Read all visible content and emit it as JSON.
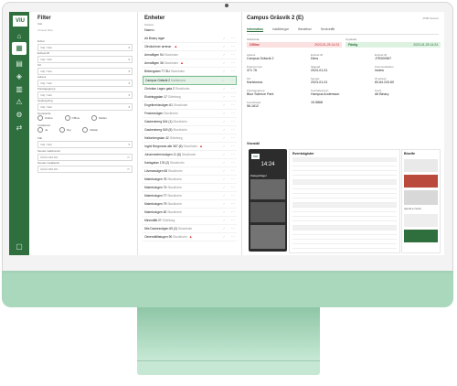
{
  "sidebar": {
    "logo_text": "VIU",
    "icons": [
      "home-icon",
      "grid-icon",
      "building-icon",
      "map-icon",
      "chart-icon",
      "alert-icon",
      "settings-icon",
      "swap-icon",
      "info-icon"
    ],
    "active_index": 1
  },
  "filter": {
    "title": "Filter",
    "saved_label": "Sök",
    "saved_value": "Choose filter",
    "groups": [
      {
        "label": "Enhet",
        "value": "Välj / Sätt"
      },
      {
        "label": "Enhets ID",
        "value": "Välj / Sätt"
      },
      {
        "label": "Ort",
        "value": "Välj / Sätt"
      },
      {
        "label": "Adress",
        "value": "Välj / Sätt"
      },
      {
        "label": "Företagsgrupp",
        "value": "Välj / Sätt"
      },
      {
        "label": "Uppkoppling",
        "value": "Välj / Sätt"
      }
    ],
    "status_label": "Nuvarande",
    "status_options": [
      "Online",
      "Offline",
      "Mellan"
    ],
    "installed_label": "Installerad",
    "installed_options": [
      "Ja",
      "Nej",
      "Mellan"
    ],
    "field_label": "Fält",
    "field_value": "Välj / Sätt",
    "date_from_label": "Senast inaktiverad",
    "date_from_value": "ÅÅÅÅ-MM-DD",
    "date_to_label": "Senast installerad",
    "date_to_value": "ÅÅÅÅ-MM-DD"
  },
  "units": {
    "title": "Enheter",
    "sort_label": "Sortera",
    "sort_value": "Namn",
    "items": [
      {
        "name": "Alt Binary lager",
        "city": "",
        "warn": false
      },
      {
        "name": "Olrvikofoner arrenar",
        "city": "",
        "warn": true
      },
      {
        "name": "Armatågen 54",
        "city": "Stockholm",
        "warn": false
      },
      {
        "name": "Armatågen 36",
        "city": "Stockholm",
        "warn": true
      },
      {
        "name": "Birkengatan 77 SU",
        "city": "Stockholm",
        "warn": false
      },
      {
        "name": "Campus Gräsvik 2",
        "city": "Karlskrona",
        "warn": false
      },
      {
        "name": "Christian Lagns gata 2",
        "city": "Stockholm",
        "warn": false
      },
      {
        "name": "Ekotringgatan 17",
        "city": "Göteborg",
        "warn": false
      },
      {
        "name": "Engelbrektsvägen 61",
        "city": "Stockholm",
        "warn": false
      },
      {
        "name": "Finskesvägen",
        "city": "Stockholm",
        "warn": false
      },
      {
        "name": "Gasbersberg 544 (1)",
        "city": "Stockholm",
        "warn": false
      },
      {
        "name": "Gasbersberg 549 (5)",
        "city": "Stockholm",
        "warn": false
      },
      {
        "name": "Hallonbergstan 42",
        "city": "Göteborg",
        "warn": false
      },
      {
        "name": "Ingrid Bergmans alle 367 (6)",
        "city": "Stockholm",
        "warn": true
      },
      {
        "name": "Johannesfrensvägen 11 (6)",
        "city": "Stockholm",
        "warn": false
      },
      {
        "name": "Karlsgatan 176 (2)",
        "city": "Stockholm",
        "warn": false
      },
      {
        "name": "Lövmasvägen 65",
        "city": "Stockholm",
        "warn": false
      },
      {
        "name": "Malmbolugen 76",
        "city": "Stockholm",
        "warn": false
      },
      {
        "name": "Malmbolugen 74",
        "city": "Stockholm",
        "warn": false
      },
      {
        "name": "Malmbolugen 77",
        "city": "Stockholm",
        "warn": false
      },
      {
        "name": "Malmbolugen 79",
        "city": "Stockholm",
        "warn": false
      },
      {
        "name": "Malmbolugen 82",
        "city": "Stockholm",
        "warn": false
      },
      {
        "name": "Minestfält 27",
        "city": "Göteborg",
        "warn": false
      },
      {
        "name": "Nils Dackesvägen 69 (2)",
        "city": "Stockholm",
        "warn": false
      },
      {
        "name": "Olmersfälltstugen 90",
        "city": "Stockholm",
        "warn": true
      }
    ],
    "selected_index": 5
  },
  "detail": {
    "title": "Campus Gräsvik 2 (E)",
    "top_right": "2598 Sessen",
    "tabs": [
      "Information",
      "Inställningar",
      "Händelser",
      "Servicelått"
    ],
    "active_tab": 0,
    "status_left_label": "Webbsida",
    "status_left_tag": "Offline",
    "status_left_time": "2023-01-25 14:24",
    "status_right_label": "Uppdatat",
    "status_right_tag": "Färdig",
    "status_right_time": "2023-01-25 14:24",
    "fields": [
      {
        "k": "Adress",
        "v": "Campus Gräsvik 2"
      },
      {
        "k": "Enhets ID",
        "v": "Dims"
      },
      {
        "k": "Enhets ID",
        "v": "J7E000967"
      },
      {
        "k": "Postnummer",
        "v": "371 76"
      },
      {
        "k": "Skapad",
        "v": "2024-01-01"
      },
      {
        "k": "Kommunikation",
        "v": "inview"
      },
      {
        "k": "Ort",
        "v": "Karlskrona"
      },
      {
        "k": "Senast",
        "v": "2023-01-01"
      },
      {
        "k": "IP adress",
        "v": "83.84.243.60"
      },
      {
        "k": "Företagsgrupp",
        "v": "Blue Science Park"
      },
      {
        "k": "Kontaktperson",
        "v": "Hampus Andersson"
      },
      {
        "k": "Kund",
        "v": "Alt Binary"
      },
      {
        "k": "Koordinater",
        "v": "56.1612"
      },
      {
        "k": "",
        "v": "15.5868"
      }
    ],
    "view_title": "Visnstäl",
    "phone_time": "14:24",
    "phone_logo": "VIU",
    "phone_header": "Kategorilager",
    "schedule_title": "Eventskgister",
    "side_title": "Bioxife",
    "side_caption": "Agenda en Sentis"
  },
  "colors": {
    "brand": "#2e6f3d",
    "offline": "#c23a3a",
    "online": "#2e6f3d",
    "stand": "#a9d8bd"
  }
}
